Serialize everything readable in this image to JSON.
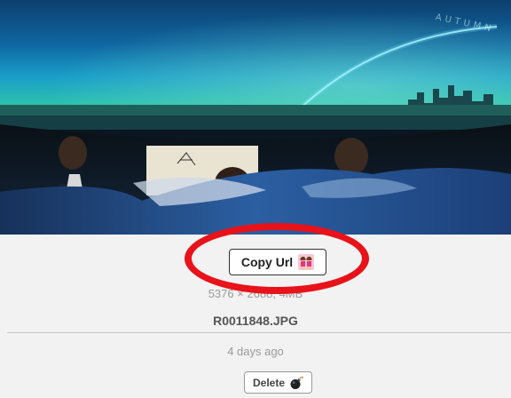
{
  "photo": {
    "alt": "R0011848.JPG",
    "watermark": "AUTUMN"
  },
  "actions": {
    "copy_url_label": "Copy Url",
    "copy_url_icon": "two-girls-emoji-icon",
    "delete_label": "Delete",
    "delete_icon": "bomb-emoji-icon"
  },
  "image_info": {
    "dimensions": "5376 × 2688, 4MB",
    "filename": "R0011848.JPG",
    "uploaded": "4 days ago"
  },
  "annotation": {
    "highlight_color": "#e8121a"
  }
}
